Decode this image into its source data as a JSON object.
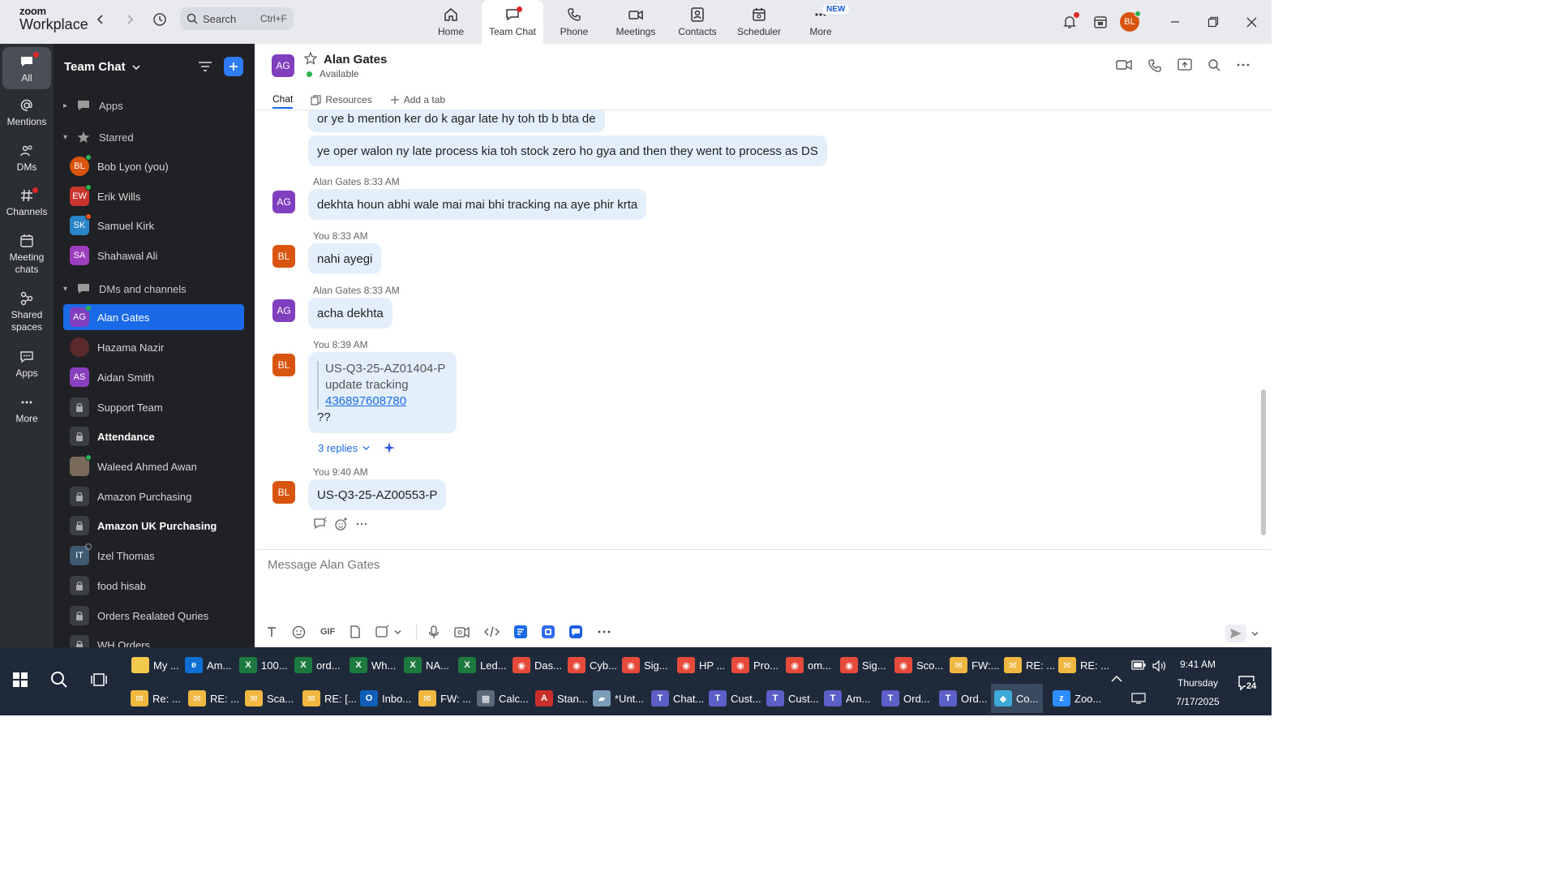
{
  "app": {
    "logo_line1": "zoom",
    "logo_line2": "Workplace",
    "search_label": "Search",
    "search_shortcut": "Ctrl+F",
    "user_initials": "BL"
  },
  "nav": {
    "tabs": [
      {
        "label": "Home",
        "icon": "home-icon"
      },
      {
        "label": "Team Chat",
        "icon": "chat-bubble-icon",
        "active": true
      },
      {
        "label": "Phone",
        "icon": "phone-icon"
      },
      {
        "label": "Meetings",
        "icon": "video-camera-icon"
      },
      {
        "label": "Contacts",
        "icon": "contact-card-icon"
      },
      {
        "label": "Scheduler",
        "icon": "calendar-icon"
      },
      {
        "label": "More",
        "icon": "more-dots-icon"
      }
    ],
    "new_badge": "NEW"
  },
  "rail": {
    "items": [
      "All",
      "Mentions",
      "DMs",
      "Channels",
      "Meeting chats",
      "Shared spaces",
      "Apps",
      "More"
    ]
  },
  "sidebar": {
    "title": "Team Chat",
    "sections": {
      "apps": "Apps",
      "starred": "Starred",
      "dms": "DMs and channels"
    },
    "starred": [
      {
        "initials": "BL",
        "name": "Bob Lyon (you)",
        "color": "#d9550f"
      },
      {
        "initials": "EW",
        "name": "Erik Wills",
        "color": "#c9342d"
      },
      {
        "initials": "SK",
        "name": "Samuel Kirk",
        "color": "#2a86c9"
      },
      {
        "initials": "SA",
        "name": "Shahawal Ali",
        "color": "#9b3fbf"
      }
    ],
    "channels": [
      {
        "initials": "AG",
        "name": "Alan Gates",
        "color": "#7f3fbf"
      },
      {
        "initials": "",
        "name": "Hazama Nazir",
        "color": "#5a2a2a"
      },
      {
        "initials": "AS",
        "name": "Aidan Smith",
        "color": "#8a3fbf"
      },
      {
        "initials": "",
        "name": "Support Team",
        "color": "#3b3e43"
      },
      {
        "initials": "",
        "name": "Attendance",
        "color": "#3b3e43"
      },
      {
        "initials": "",
        "name": "Waleed Ahmed Awan",
        "color": "#7a6a5a"
      },
      {
        "initials": "",
        "name": "Amazon Purchasing",
        "color": "#3b3e43"
      },
      {
        "initials": "",
        "name": "Amazon UK Purchasing",
        "color": "#3b3e43"
      },
      {
        "initials": "IT",
        "name": "Izel Thomas",
        "color": "#3d5a70"
      },
      {
        "initials": "",
        "name": "food hisab",
        "color": "#3b3e43"
      },
      {
        "initials": "",
        "name": "Orders Realated Quries",
        "color": "#3b3e43"
      },
      {
        "initials": "",
        "name": "WH Orders",
        "color": "#3b3e43"
      }
    ]
  },
  "chat": {
    "contact_initials": "AG",
    "contact_name": "Alan Gates",
    "status": "Available",
    "tabs": [
      "Chat",
      "Resources",
      "Add a tab"
    ],
    "messages": {
      "m1": "or ye b mention ker do k agar late hy toh tb b bta de",
      "m2": "ye oper walon ny late process kia toh stock zero ho gya and then they went to process as DS",
      "meta3": "Alan Gates 8:33 AM",
      "m3": "dekhta houn abhi wale mai mai bhi tracking na aye phir krta",
      "meta4": "You 8:33 AM",
      "m4": "nahi ayegi",
      "meta5": "Alan Gates 8:33 AM",
      "m5": "acha dekhta",
      "meta6": "You 8:39 AM",
      "q_line1": "US-Q3-25-AZ01404-P",
      "q_line2": "update tracking",
      "q_link": "436897608780",
      "m6": "??",
      "replies": "3 replies",
      "meta7": "You 9:40 AM",
      "m7": "US-Q3-25-AZ00553-P"
    },
    "you_initials": "BL",
    "composer_placeholder": "Message Alan Gates",
    "gif_label": "GIF"
  },
  "taskbar": {
    "row1": [
      "My ...",
      "Am...",
      "100...",
      "ord...",
      "Wh...",
      "NA...",
      "Led...",
      "Das...",
      "Cyb...",
      "Sig...",
      "HP ...",
      "Pro...",
      "om...",
      "Sig...",
      "Sco...",
      "FW:...",
      "RE: ...",
      "RE: ..."
    ],
    "row2": [
      "Re: ...",
      "RE: ...",
      "Sca...",
      "RE: [...",
      "Inbo...",
      "FW: ...",
      "Calc...",
      "Stan...",
      "*Unt...",
      "Chat...",
      "Cust...",
      "Cust...",
      "Am...",
      "Ord...",
      "Ord...",
      "Co...",
      "Zoo..."
    ],
    "time": "9:41 AM",
    "day": "Thursday",
    "date": "7/17/2025",
    "notif_count": "24"
  }
}
